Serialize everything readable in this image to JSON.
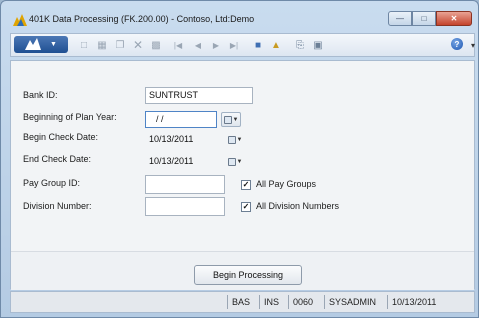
{
  "window": {
    "title": "401K Data Processing (FK.200.00) - Contoso, Ltd:Demo"
  },
  "toolbar": {
    "app_menu_icon": "app-menu-icon",
    "icons": [
      "new-icon",
      "save-icon",
      "copy-icon",
      "delete-icon",
      "insert-icon",
      "first-icon",
      "previous-icon",
      "next-icon",
      "last-icon",
      "attach-icon",
      "note-icon",
      "print-icon",
      "preview-icon",
      "help-icon"
    ]
  },
  "form": {
    "bank_id": {
      "label": "Bank ID:",
      "value": "SUNTRUST"
    },
    "beginning_of_plan_year": {
      "label": "Beginning of Plan Year:",
      "value": "/ /"
    },
    "begin_check_date": {
      "label": "Begin Check Date:",
      "value": "10/13/2011"
    },
    "end_check_date": {
      "label": "End Check Date:",
      "value": "10/13/2011"
    },
    "pay_group_id": {
      "label": "Pay Group ID:",
      "value": "",
      "checkbox_label": "All Pay Groups",
      "checked": true
    },
    "division_number": {
      "label": "Division Number:",
      "value": "",
      "checkbox_label": "All Division Numbers",
      "checked": true
    }
  },
  "actions": {
    "begin_processing": "Begin Processing"
  },
  "statusbar": {
    "cells": [
      "BAS",
      "INS",
      "0060",
      "SYSADMIN",
      "10/13/2011"
    ]
  },
  "colors": {
    "title_bar": "#c9dcef",
    "app_menu": "#1f4f92",
    "close_button": "#c4432c"
  }
}
